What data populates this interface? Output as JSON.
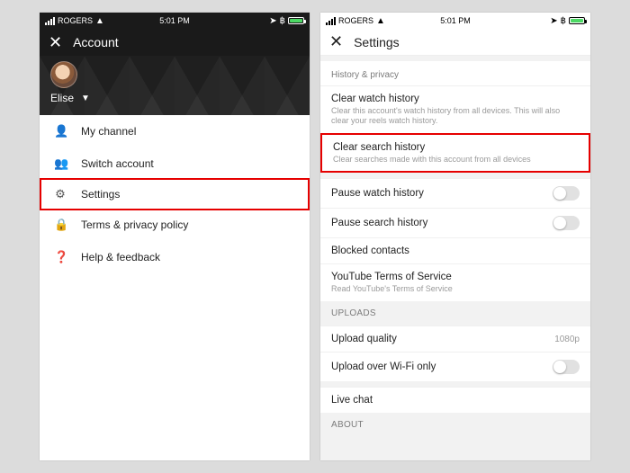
{
  "status": {
    "carrier": "ROGERS",
    "time": "5:01 PM"
  },
  "left": {
    "header_title": "Account",
    "username": "Elise",
    "menu": {
      "my_channel": "My channel",
      "switch_account": "Switch account",
      "settings": "Settings",
      "terms": "Terms & privacy policy",
      "help": "Help & feedback"
    }
  },
  "right": {
    "header_title": "Settings",
    "sections": {
      "history_privacy": "History & privacy",
      "uploads": "UPLOADS",
      "about": "ABOUT"
    },
    "items": {
      "clear_watch": {
        "title": "Clear watch history",
        "sub": "Clear this account's watch history from all devices. This will also clear your reels watch history."
      },
      "clear_search": {
        "title": "Clear search history",
        "sub": "Clear searches made with this account from all devices"
      },
      "pause_watch": {
        "title": "Pause watch history"
      },
      "pause_search": {
        "title": "Pause search history"
      },
      "blocked": {
        "title": "Blocked contacts"
      },
      "tos": {
        "title": "YouTube Terms of Service",
        "sub": "Read YouTube's Terms of Service"
      },
      "upload_quality": {
        "title": "Upload quality",
        "value": "1080p"
      },
      "upload_wifi": {
        "title": "Upload over Wi-Fi only"
      },
      "live_chat": {
        "title": "Live chat"
      }
    }
  }
}
